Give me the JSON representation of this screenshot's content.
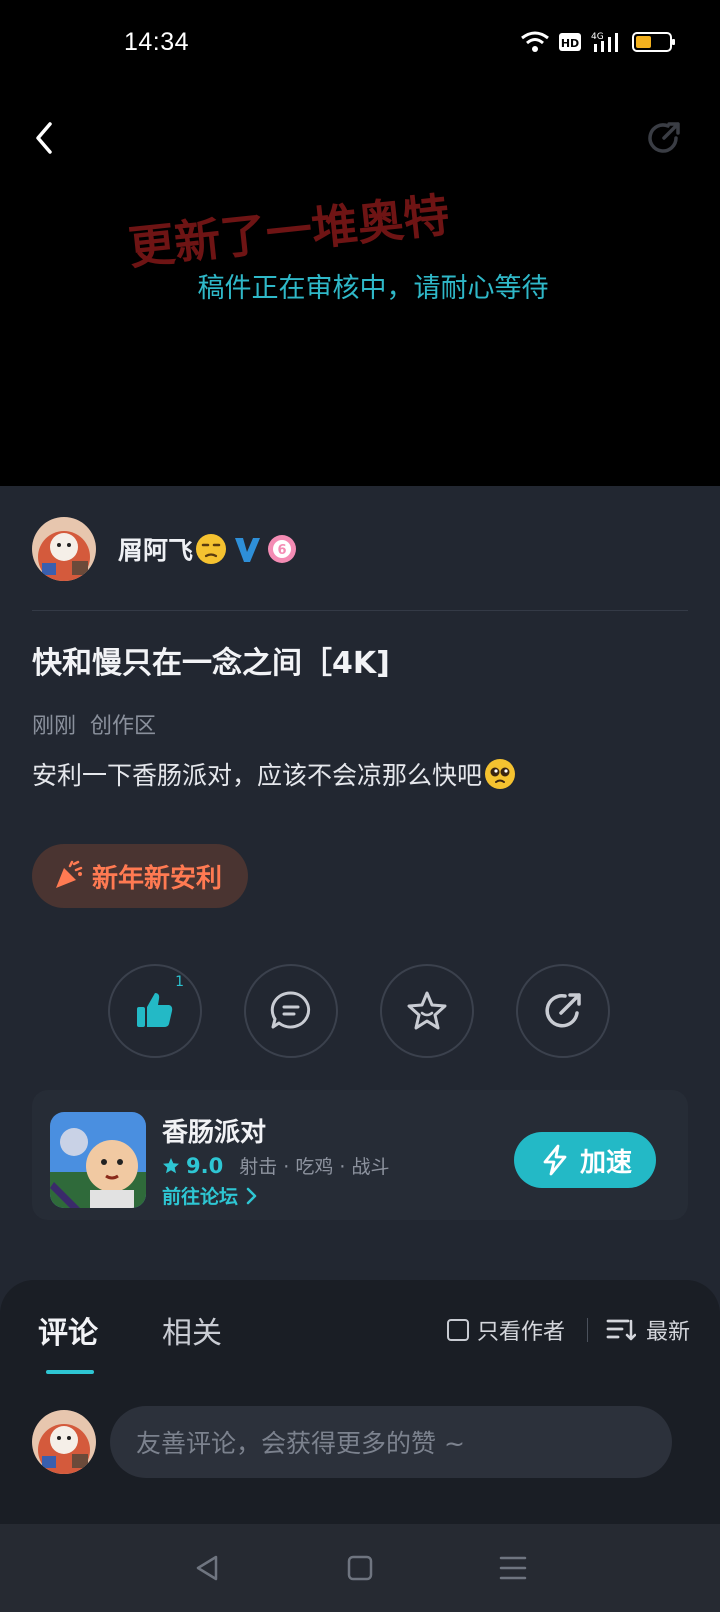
{
  "status_bar": {
    "time": "14:34",
    "network": "4G",
    "hd": "HD"
  },
  "video": {
    "overlay_text": "更新了一堆奥特",
    "review_notice": "稿件正在审核中，请耐心等待"
  },
  "author": {
    "name": "屑阿飞",
    "level": "6"
  },
  "post": {
    "title": "快和慢只在一念之间［4K]",
    "time": "刚刚",
    "section": "创作区",
    "body": "安利一下香肠派对，应该不会凉那么快吧"
  },
  "tag": {
    "label": "新年新安利"
  },
  "actions": {
    "like_count": "1"
  },
  "game": {
    "name": "香肠派对",
    "rating": "9.0",
    "tags": "射击 · 吃鸡 · 战斗",
    "forum_link": "前往论坛",
    "speed_button": "加速"
  },
  "comments": {
    "tab_comments": "评论",
    "tab_related": "相关",
    "author_only": "只看作者",
    "sort": "最新",
    "input_placeholder": "友善评论，会获得更多的赞 ~"
  },
  "colors": {
    "accent": "#2ec6d3",
    "tag_text": "#ff7a52",
    "panel": "#222731"
  }
}
